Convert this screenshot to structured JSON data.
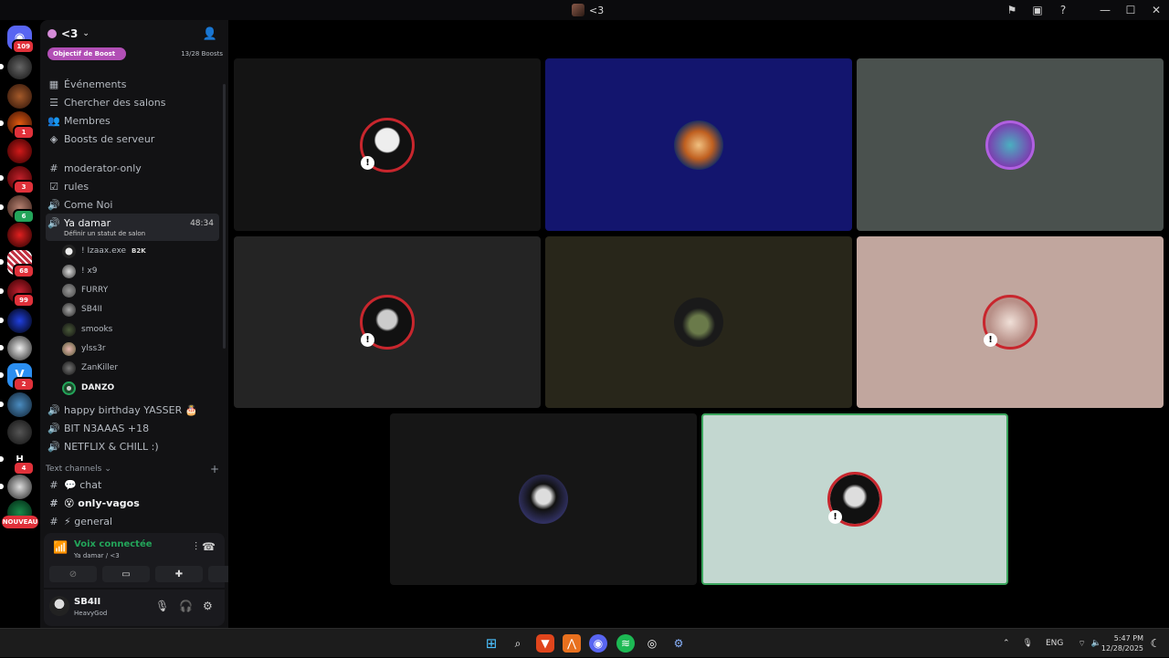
{
  "window": {
    "title": "<3",
    "controls": {
      "minimize": "—",
      "maximize": "☐",
      "close": "✕"
    }
  },
  "server": {
    "name": "<3",
    "boost_goal_label": "Objectif de Boost",
    "boost_count": "13/28 Boosts"
  },
  "rail": {
    "badges": [
      "109",
      "1",
      "3",
      "6",
      "68",
      "99",
      "2",
      "4"
    ],
    "new_label": "NOUVEAU"
  },
  "sidebar": {
    "top_items": [
      {
        "label": "Événements",
        "icon": "calendar-icon"
      },
      {
        "label": "Chercher des salons",
        "icon": "list-search-icon"
      },
      {
        "label": "Membres",
        "icon": "members-icon"
      },
      {
        "label": "Boosts de serveur",
        "icon": "boost-icon"
      }
    ],
    "channels": [
      {
        "label": "moderator-only",
        "icon": "hash-icon"
      },
      {
        "label": "rules",
        "icon": "rules-icon"
      },
      {
        "label": "Come Noi",
        "icon": "voice-icon"
      }
    ],
    "active_voice": {
      "label": "Ya damar",
      "time": "48:34",
      "status_hint": "Définir un statut de salon"
    },
    "members": [
      {
        "name": "! Izaax.exe",
        "tag": "B2K"
      },
      {
        "name": "! x9",
        "tag": ""
      },
      {
        "name": "FURRY",
        "tag": ""
      },
      {
        "name": "SB4II",
        "tag": ""
      },
      {
        "name": "smooks",
        "tag": ""
      },
      {
        "name": "ylss3r",
        "tag": ""
      },
      {
        "name": "ZanKiller",
        "tag": ""
      },
      {
        "name": "DANZO",
        "tag": ""
      }
    ],
    "voice_channels": [
      {
        "label": "happy birthday YASSER 🎂"
      },
      {
        "label": "BIT N3AAAS +18"
      },
      {
        "label": "NETFLIX & CHILL :)"
      }
    ],
    "text_section": "Text channels",
    "text_channels": [
      {
        "label": "💬 chat",
        "bold": false
      },
      {
        "label": "😵 only-vagos",
        "bold": true
      },
      {
        "label": "⚡ general",
        "bold": false
      }
    ]
  },
  "voice_panel": {
    "title": "Voix connectée",
    "subtitle": "Ya damar / <3"
  },
  "user": {
    "name": "SB4II",
    "status": "HeavyGod"
  },
  "taskbar": {
    "lang": "ENG",
    "time": "5:47 PM",
    "date": "12/28/2025"
  },
  "colors": {
    "accent_green": "#23a55a",
    "danger": "#e0313a",
    "boost_pink": "#b24fb6"
  }
}
